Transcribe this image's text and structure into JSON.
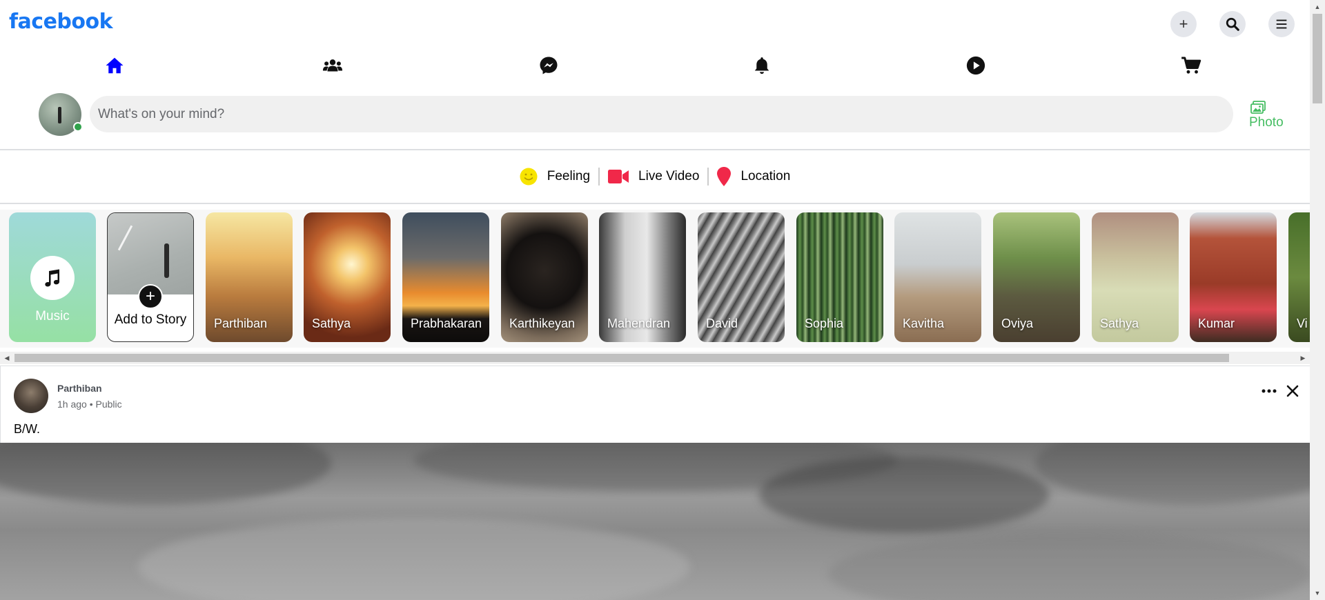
{
  "header": {
    "logo": "facebook",
    "buttons": [
      {
        "name": "create",
        "icon": "plus-icon",
        "glyph": "+"
      },
      {
        "name": "search",
        "icon": "search-icon"
      },
      {
        "name": "menu",
        "icon": "menu-icon"
      }
    ]
  },
  "nav": {
    "items": [
      {
        "name": "home",
        "icon": "home-icon",
        "active": true
      },
      {
        "name": "friends",
        "icon": "friends-icon",
        "active": false
      },
      {
        "name": "messenger",
        "icon": "messenger-icon",
        "active": false
      },
      {
        "name": "notifications",
        "icon": "bell-icon",
        "active": false
      },
      {
        "name": "watch",
        "icon": "play-icon",
        "active": false
      },
      {
        "name": "marketplace",
        "icon": "cart-icon",
        "active": false
      }
    ],
    "active_color": "#0000ff"
  },
  "composer": {
    "placeholder": "What's on your mind?",
    "photo_label": "Photo",
    "photo_color": "#45bd62"
  },
  "actions": [
    {
      "label": "Feeling",
      "icon": "smiley-icon",
      "color": "#f7e400"
    },
    {
      "label": "Live Video",
      "icon": "video-camera-icon",
      "color": "#f02849"
    },
    {
      "label": "Location",
      "icon": "location-pin-icon",
      "color": "#f02849"
    }
  ],
  "stories": {
    "music_label": "Music",
    "add_label": "Add to Story",
    "add_glyph": "+",
    "items": [
      {
        "name": "Parthiban"
      },
      {
        "name": "Sathya"
      },
      {
        "name": "Prabhakaran"
      },
      {
        "name": "Karthikeyan"
      },
      {
        "name": "Mahendran"
      },
      {
        "name": "David"
      },
      {
        "name": "Sophia"
      },
      {
        "name": "Kavitha"
      },
      {
        "name": "Oviya"
      },
      {
        "name": "Sathya"
      },
      {
        "name": "Kumar"
      },
      {
        "name": "Vi"
      }
    ]
  },
  "post": {
    "author": "Parthiban",
    "meta": "1h ago • Public",
    "text": "B/W."
  },
  "scrollbar": {
    "left_arrow": "◀",
    "right_arrow": "▶",
    "up_arrow": "▲",
    "down_arrow": "▼"
  }
}
